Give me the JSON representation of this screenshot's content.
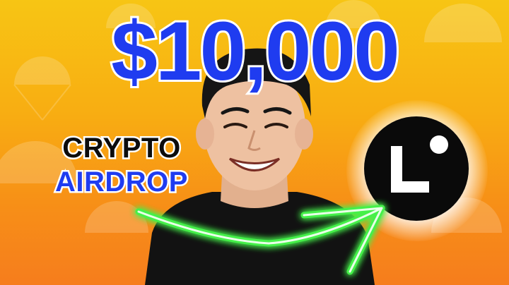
{
  "thumbnail": {
    "headline": "$10,000",
    "line1": "CRYPTO",
    "line2": "AIRDROP"
  },
  "colors": {
    "headline": "#1f3cf0",
    "background_top": "#f7c514",
    "background_bottom": "#f67d1d",
    "arrow_glow": "#45f04a",
    "logo_bg": "#0a0a0a"
  },
  "icons": [
    "parachute-icon",
    "crypto-token-logo-icon",
    "curved-arrow-icon"
  ]
}
